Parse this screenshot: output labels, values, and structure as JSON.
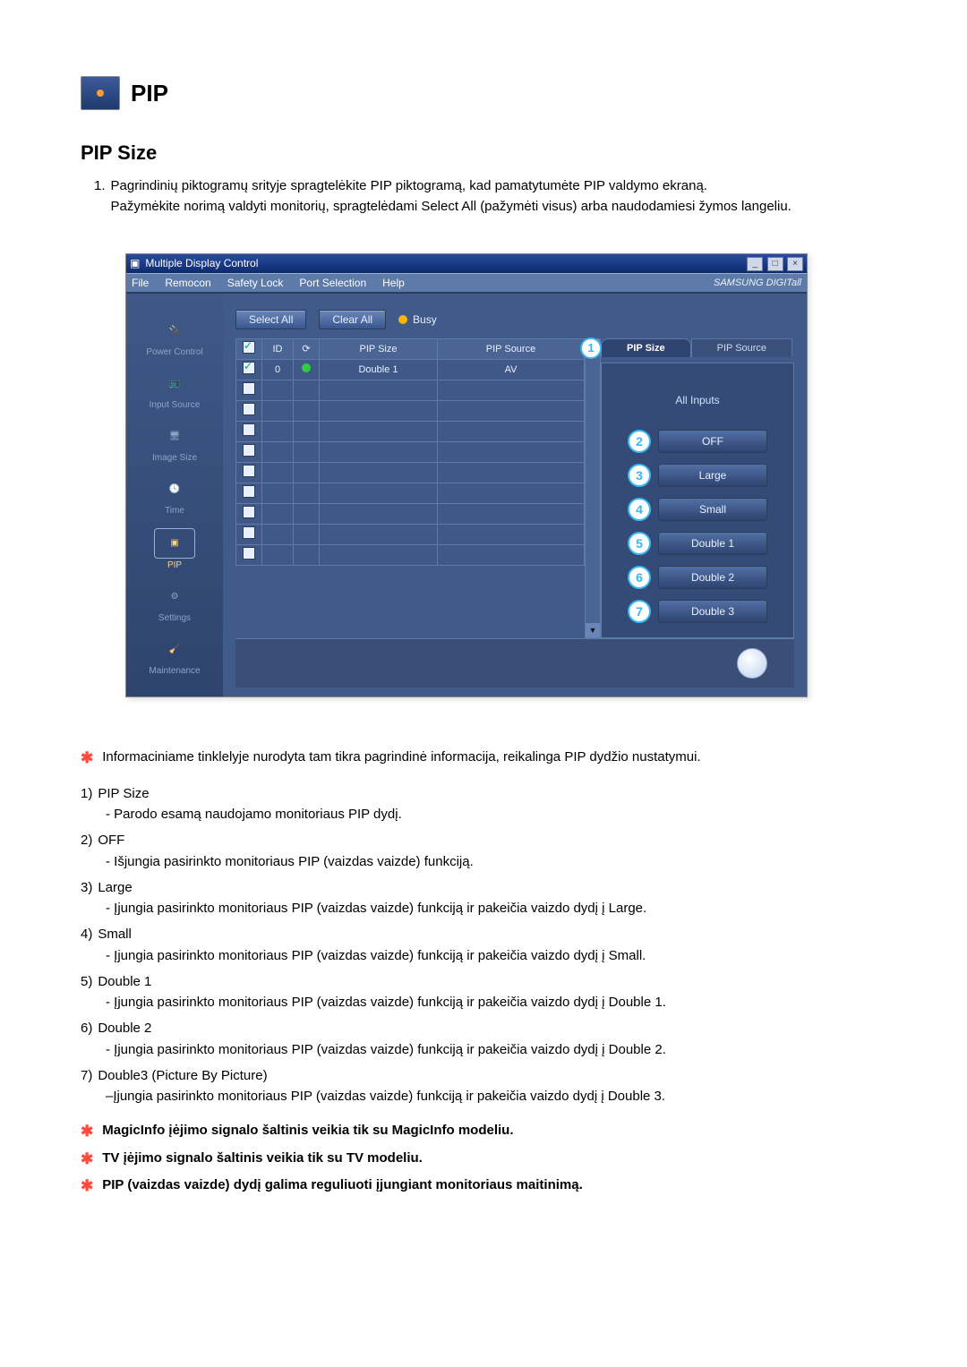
{
  "title": "PIP",
  "section_title": "PIP Size",
  "intro": {
    "num": "1.",
    "line1": "Pagrindinių piktogramų srityje spragtelėkite PIP piktogramą, kad pamatytumėte PIP valdymo ekraną.",
    "line2": "Pažymėkite norimą valdyti monitorių, spragtelėdami Select All (pažymėti visus) arba naudodamiesi žymos langeliu."
  },
  "shot": {
    "titlebar": "Multiple Display Control",
    "menu": [
      "File",
      "Remocon",
      "Safety Lock",
      "Port Selection",
      "Help"
    ],
    "brand": "SAMSUNG DIGITall",
    "toolbar": {
      "select_all": "Select All",
      "clear_all": "Clear All",
      "busy": "Busy"
    },
    "sidebar": [
      "Power Control",
      "Input Source",
      "Image Size",
      "Time",
      "PIP",
      "Settings",
      "Maintenance"
    ],
    "sidebar_active_index": 4,
    "grid": {
      "headers": [
        "",
        "ID",
        "",
        "PIP Size",
        "PIP Source"
      ],
      "row": {
        "id": "0",
        "pip_size": "Double 1",
        "pip_source": "AV"
      }
    },
    "tabs": {
      "active": "PIP Size",
      "inactive": "PIP Source"
    },
    "all_inputs": "All Inputs",
    "options": [
      "OFF",
      "Large",
      "Small",
      "Double 1",
      "Double 2",
      "Double 3"
    ]
  },
  "info_star": "Informaciniame tinklelyje nurodyta tam tikra pagrindinė informacija, reikalinga PIP dydžio nustatymui.",
  "items": [
    {
      "n": "1)",
      "hdr": "PIP Size",
      "sub": "- Parodo esamą naudojamo monitoriaus PIP dydį."
    },
    {
      "n": "2)",
      "hdr": "OFF",
      "sub": "- Išjungia pasirinkto monitoriaus PIP (vaizdas vaizde) funkciją."
    },
    {
      "n": "3)",
      "hdr": "Large",
      "sub": "- Įjungia pasirinkto monitoriaus PIP (vaizdas vaizde) funkciją ir pakeičia vaizdo dydį į Large."
    },
    {
      "n": "4)",
      "hdr": "Small",
      "sub": "- Įjungia pasirinkto monitoriaus PIP (vaizdas vaizde) funkciją ir pakeičia vaizdo dydį į Small."
    },
    {
      "n": "5)",
      "hdr": "Double 1",
      "sub": "- Įjungia pasirinkto monitoriaus PIP (vaizdas vaizde) funkciją ir pakeičia vaizdo dydį į Double 1."
    },
    {
      "n": "6)",
      "hdr": "Double 2",
      "sub": "- Įjungia pasirinkto monitoriaus PIP (vaizdas vaizde) funkciją ir pakeičia vaizdo dydį į Double 2."
    },
    {
      "n": "7)",
      "hdr": "Double3 (Picture By Picture)",
      "sub": "–Įjungia pasirinkto monitoriaus PIP (vaizdas vaizde) funkciją ir pakeičia vaizdo dydį į Double 3."
    }
  ],
  "notes": [
    "MagicInfo įėjimo signalo šaltinis veikia tik su MagicInfo modeliu.",
    "TV įėjimo signalo šaltinis veikia tik su TV modeliu.",
    "PIP (vaizdas vaizde) dydį galima reguliuoti įjungiant monitoriaus maitinimą."
  ]
}
